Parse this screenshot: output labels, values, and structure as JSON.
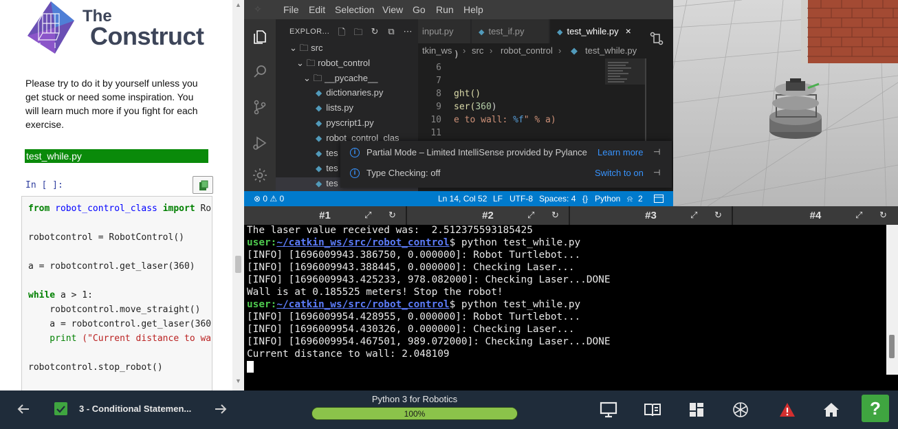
{
  "notebook": {
    "logo_the": "The",
    "logo_construct": "Construct",
    "intro_text": "Please try to do it by yourself unless you get stuck or need some inspiration. You will learn much more if you fight for each exercise.",
    "file_label": "test_while.py",
    "in_prompt": "In [ ]:",
    "code": {
      "l1_kw": "from",
      "l1_mod": "robot_control_class",
      "l1_kw2": "import",
      "l1_rest": " Ro",
      "l2": "robotcontrol = RobotControl()",
      "l3": "a = robotcontrol.get_laser(360)",
      "l4_kw": "while",
      "l4_rest": " a > 1:",
      "l5": "    robotcontrol.move_straight()",
      "l6": "    a = robotcontrol.get_laser(360",
      "l7_fn": "    print",
      "l7_str": " (\"Current distance to wa",
      "l8": "robotcontrol.stop_robot()"
    }
  },
  "vscode": {
    "menu": [
      "File",
      "Edit",
      "Selection",
      "View",
      "Go",
      "Run",
      "Help"
    ],
    "explorer_title": "EXPLOR...",
    "tree": [
      "src",
      "robot_control",
      "__pycache__",
      "dictionaries.py",
      "lists.py",
      "pyscript1.py",
      "robot_control_clas",
      "tes",
      "tes",
      "tes"
    ],
    "tabs": [
      "input.py",
      "test_if.py",
      "test_while.py"
    ],
    "close_glyph": "×",
    "breadcrumb": [
      "tkin_ws",
      "src",
      "robot_control",
      "test_while.py"
    ],
    "line_numbers": [
      "6",
      "7",
      "8",
      "9",
      "10",
      "11"
    ],
    "code_lines": {
      "l5": ")",
      "l8": "ght()",
      "l9_a": "ser(",
      "l9_b": "360",
      "l9_c": ")",
      "l10_a": "e to wall: ",
      "l10_b": "%f",
      "l10_c": "\" % a)"
    },
    "notifications": [
      {
        "text": "Partial Mode – Limited IntelliSense provided by Pylance",
        "link": "Learn more"
      },
      {
        "text": "Type Checking: off",
        "link": "Switch to on"
      }
    ],
    "status": {
      "problems": "⊗ 0 ⚠ 0",
      "position": "Ln 14, Col 52",
      "eol": "LF",
      "encoding": "UTF-8",
      "spaces": "Spaces: 4",
      "language": "Python",
      "notifications_count": "2"
    }
  },
  "terminal_tabs": [
    "#1",
    "#2",
    "#3",
    "#4"
  ],
  "terminal": {
    "line0": "The laser value received was:  2.512375593185425",
    "prompt_user": "user",
    "prompt_path": "~/catkin_ws/src/robot_control",
    "prompt_cmd": "$ python test_while.py",
    "run1": [
      "[INFO] [1696009943.386750, 0.000000]: Robot Turtlebot...",
      "[INFO] [1696009943.388445, 0.000000]: Checking Laser...",
      "[INFO] [1696009943.425233, 978.082000]: Checking Laser...DONE",
      "Wall is at 0.185525 meters! Stop the robot!"
    ],
    "run2": [
      "[INFO] [1696009954.428955, 0.000000]: Robot Turtlebot...",
      "[INFO] [1696009954.430326, 0.000000]: Checking Laser...",
      "[INFO] [1696009954.467501, 989.072000]: Checking Laser...DONE",
      "Current distance to wall: 2.048109"
    ]
  },
  "bottom": {
    "lesson": "3 - Conditional Statemen...",
    "course": "Python 3 for Robotics",
    "progress_label": "100%",
    "progress_value": 1.0,
    "help": "?"
  },
  "colors": {
    "file_bar": "#0a8a0a",
    "vscode_status": "#007acc",
    "progress": "#8bc34a",
    "help_button": "#3fa540"
  }
}
